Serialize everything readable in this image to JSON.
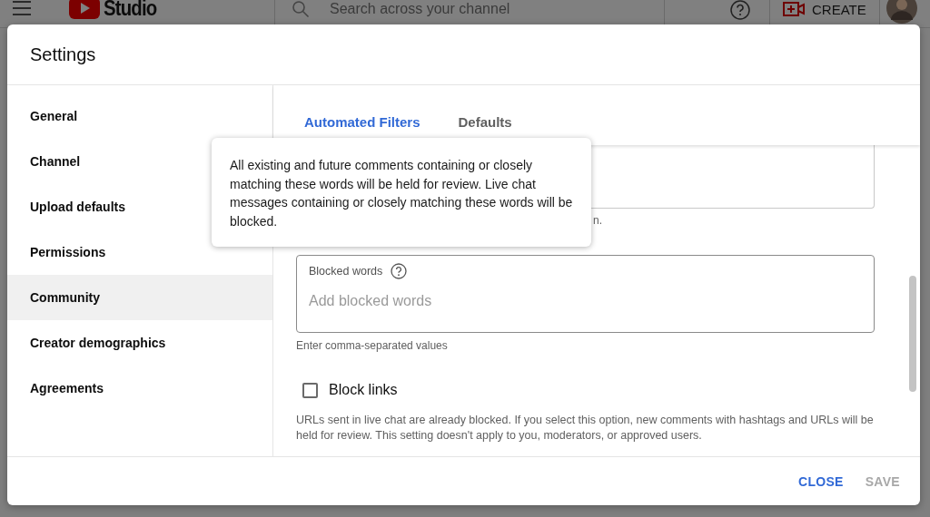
{
  "topbar": {
    "logo": "Studio",
    "search": {
      "placeholder": "Search across your channel"
    },
    "create_button": "CREATE"
  },
  "dialog": {
    "title": "Settings",
    "sidebar": {
      "items": [
        {
          "label": "General",
          "selected": false
        },
        {
          "label": "Channel",
          "selected": false
        },
        {
          "label": "Upload defaults",
          "selected": false
        },
        {
          "label": "Permissions",
          "selected": false
        },
        {
          "label": "Community",
          "selected": true
        },
        {
          "label": "Creator demographics",
          "selected": false
        },
        {
          "label": "Agreements",
          "selected": false
        }
      ]
    },
    "tabs": [
      {
        "label": "Automated Filters",
        "selected": true
      },
      {
        "label": "Defaults",
        "selected": false
      }
    ],
    "covered_hint": "n.",
    "blocked_words": {
      "label": "Blocked words",
      "placeholder": "Add blocked words",
      "hint": "Enter comma-separated values"
    },
    "block_links": {
      "label": "Block links",
      "checked": false,
      "description": "URLs sent in live chat are already blocked. If you select this option, new comments with hashtags and URLs will be held for review. This setting doesn't apply to you, moderators, or approved users."
    },
    "tooltip": "All existing and future comments containing or closely matching these words will be held for review. Live chat messages containing or closely matching these words will be blocked.",
    "buttons": [
      {
        "label": "CLOSE",
        "disabled": false
      },
      {
        "label": "SAVE",
        "disabled": true
      }
    ]
  }
}
